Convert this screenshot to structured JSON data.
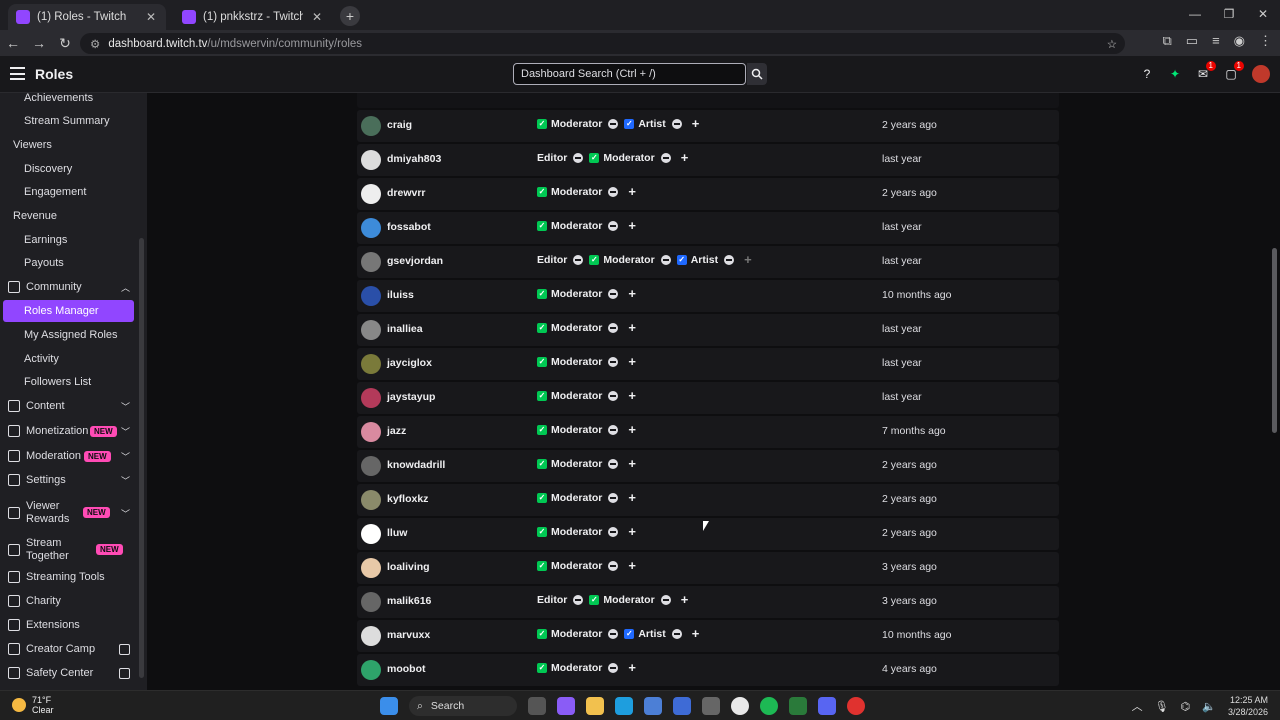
{
  "browser": {
    "tabs": [
      {
        "title": "(1) Roles - Twitch",
        "active": true
      },
      {
        "title": "(1) pnkkstrz - Twitch",
        "active": false
      }
    ],
    "url_host": "dashboard.twitch.tv",
    "url_path": "/u/mdswervin/community/roles"
  },
  "header": {
    "page_title": "Roles",
    "search_placeholder": "Dashboard Search (Ctrl + /)",
    "inbox_badge": "1",
    "notif_badge": "1"
  },
  "sidebar": {
    "achievements": "Achievements",
    "stream_summary": "Stream Summary",
    "viewers": "Viewers",
    "discovery": "Discovery",
    "engagement": "Engagement",
    "revenue": "Revenue",
    "earnings": "Earnings",
    "payouts": "Payouts",
    "community": "Community",
    "roles_manager": "Roles Manager",
    "my_assigned_roles": "My Assigned Roles",
    "activity": "Activity",
    "followers_list": "Followers List",
    "content": "Content",
    "monetization": "Monetization",
    "moderation": "Moderation",
    "settings": "Settings",
    "viewer_rewards_1": "Viewer",
    "viewer_rewards_2": "Rewards",
    "stream_together_1": "Stream",
    "stream_together_2": "Together",
    "streaming_tools": "Streaming Tools",
    "charity": "Charity",
    "extensions": "Extensions",
    "creator_camp": "Creator Camp",
    "safety_center": "Safety Center",
    "new_label": "NEW"
  },
  "roles_table": {
    "rows": [
      {
        "user": "craig",
        "roles": [
          "Moderator",
          "Artist"
        ],
        "time": "2 years ago",
        "avatar": "#4a6e5a"
      },
      {
        "user": "dmiyah803",
        "roles": [
          "Editor",
          "Moderator"
        ],
        "time": "last year",
        "avatar": "#ddd"
      },
      {
        "user": "drewvrr",
        "roles": [
          "Moderator"
        ],
        "time": "2 years ago",
        "avatar": "#eee"
      },
      {
        "user": "fossabot",
        "roles": [
          "Moderator"
        ],
        "time": "last year",
        "avatar": "#3d8bd9"
      },
      {
        "user": "gsevjordan",
        "roles": [
          "Editor",
          "Moderator",
          "Artist"
        ],
        "time": "last year",
        "avatar": "#777"
      },
      {
        "user": "iluiss",
        "roles": [
          "Moderator"
        ],
        "time": "10 months ago",
        "avatar": "#2a4fa8"
      },
      {
        "user": "inalliea",
        "roles": [
          "Moderator"
        ],
        "time": "last year",
        "avatar": "#888"
      },
      {
        "user": "jayciglox",
        "roles": [
          "Moderator"
        ],
        "time": "last year",
        "avatar": "#7a7a3a"
      },
      {
        "user": "jaystayup",
        "roles": [
          "Moderator"
        ],
        "time": "last year",
        "avatar": "#b33a5a"
      },
      {
        "user": "jazz",
        "roles": [
          "Moderator"
        ],
        "time": "7 months ago",
        "avatar": "#d98aa0"
      },
      {
        "user": "knowdadrill",
        "roles": [
          "Moderator"
        ],
        "time": "2 years ago",
        "avatar": "#666"
      },
      {
        "user": "kyfloxkz",
        "roles": [
          "Moderator"
        ],
        "time": "2 years ago",
        "avatar": "#8a8a6a"
      },
      {
        "user": "lluw",
        "roles": [
          "Moderator"
        ],
        "time": "2 years ago",
        "avatar": "#fff"
      },
      {
        "user": "loaliving",
        "roles": [
          "Moderator"
        ],
        "time": "3 years ago",
        "avatar": "#e8c9a8"
      },
      {
        "user": "malik616",
        "roles": [
          "Editor",
          "Moderator"
        ],
        "time": "3 years ago",
        "avatar": "#666"
      },
      {
        "user": "marvuxx",
        "roles": [
          "Moderator",
          "Artist"
        ],
        "time": "10 months ago",
        "avatar": "#ddd"
      },
      {
        "user": "moobot",
        "roles": [
          "Moderator"
        ],
        "time": "4 years ago",
        "avatar": "#2ea36a"
      }
    ]
  },
  "taskbar": {
    "temperature": "71°F",
    "condition": "Clear",
    "search_label": "Search",
    "time": "12:25 AM",
    "date": "3/28/2026"
  },
  "colors": {
    "accent": "#9146ff",
    "moderator": "#00c853",
    "artist": "#1f69ff",
    "new_badge": "#ff4bb5"
  }
}
